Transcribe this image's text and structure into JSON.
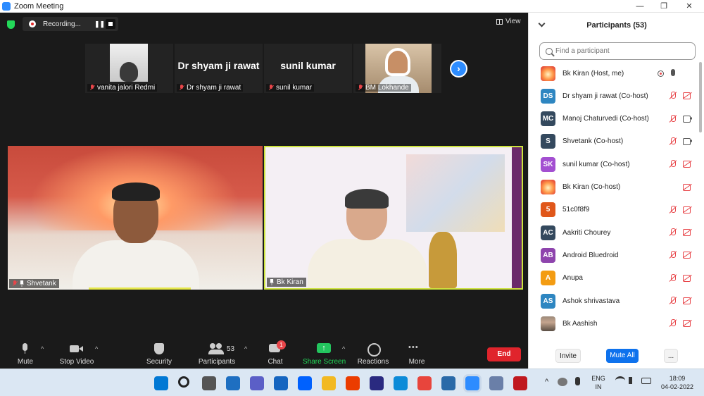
{
  "window": {
    "title": "Zoom Meeting",
    "minimize": "—",
    "maximize": "❐",
    "close": "✕"
  },
  "meeting": {
    "recording_label": "Recording...",
    "view_label": "View",
    "thumbnails": [
      {
        "label": "vanita jalori Redmi",
        "name_text": ""
      },
      {
        "label": "Dr shyam ji rawat",
        "name_text": "Dr shyam ji rawat"
      },
      {
        "label": "sunil kumar",
        "name_text": "sunil kumar"
      },
      {
        "label": "BM Lokhande",
        "name_text": ""
      }
    ],
    "tiles": [
      {
        "label": "Shvetank"
      },
      {
        "label": "Bk Kiran"
      }
    ]
  },
  "toolbar": {
    "mute": "Mute",
    "stop_video": "Stop Video",
    "security": "Security",
    "participants": "Participants",
    "participants_count": "53",
    "chat": "Chat",
    "chat_badge": "1",
    "share_screen": "Share Screen",
    "reactions": "Reactions",
    "more": "More",
    "end": "End"
  },
  "participants_panel": {
    "title": "Participants (53)",
    "search_placeholder": "Find a participant",
    "participants": [
      {
        "name": "Bk Kiran (Host, me)",
        "initials": "",
        "color": "#e8523a",
        "avatar": "sun",
        "mic": "on",
        "cam": "none",
        "rec": true
      },
      {
        "name": "Dr shyam ji rawat (Co-host)",
        "initials": "DS",
        "color": "#2e86c1",
        "avatar": "initials",
        "mic": "off",
        "cam": "off",
        "rec": false
      },
      {
        "name": "Manoj Chaturvedi (Co-host)",
        "initials": "MC",
        "color": "#34495e",
        "avatar": "initials",
        "mic": "off",
        "cam": "on",
        "rec": false
      },
      {
        "name": "Shvetank (Co-host)",
        "initials": "S",
        "color": "#34495e",
        "avatar": "initials",
        "mic": "off",
        "cam": "on",
        "rec": false
      },
      {
        "name": "sunil kumar (Co-host)",
        "initials": "SK",
        "color": "#a34fd1",
        "avatar": "initials",
        "mic": "off",
        "cam": "off",
        "rec": false
      },
      {
        "name": "Bk Kiran (Co-host)",
        "initials": "",
        "color": "#e8523a",
        "avatar": "sun",
        "mic": "none",
        "cam": "off",
        "rec": false
      },
      {
        "name": "51c0f8f9",
        "initials": "5",
        "color": "#e0571a",
        "avatar": "initials",
        "mic": "off",
        "cam": "off",
        "rec": false
      },
      {
        "name": "Aakriti Chourey",
        "initials": "AC",
        "color": "#34495e",
        "avatar": "initials",
        "mic": "off",
        "cam": "off",
        "rec": false
      },
      {
        "name": "Android Bluedroid",
        "initials": "AB",
        "color": "#8e44ad",
        "avatar": "initials",
        "mic": "off",
        "cam": "off",
        "rec": false
      },
      {
        "name": "Anupa",
        "initials": "A",
        "color": "#f39c12",
        "avatar": "initials",
        "mic": "off",
        "cam": "off",
        "rec": false
      },
      {
        "name": "Ashok shrivastava",
        "initials": "AS",
        "color": "#2e86c1",
        "avatar": "initials",
        "mic": "off",
        "cam": "off",
        "rec": false
      },
      {
        "name": "Bk Aashish",
        "initials": "",
        "color": "#9c8a7a",
        "avatar": "photo",
        "mic": "off",
        "cam": "off",
        "rec": false
      }
    ],
    "invite": "Invite",
    "mute_all": "Mute All",
    "more": "..."
  },
  "taskbar": {
    "language_top": "ENG",
    "language_bottom": "IN",
    "time": "18:09",
    "date": "04-02-2022",
    "icons": [
      "windows-icon",
      "search-icon",
      "task-view-icon",
      "widgets-icon",
      "teams-icon",
      "mail-icon",
      "dropbox-icon",
      "file-explorer-icon",
      "office-icon",
      "headset-icon",
      "edge-icon",
      "chrome-icon",
      "photos-icon",
      "zoom-icon",
      "vpn-icon",
      "mcafee-icon"
    ],
    "icon_colors": [
      "#0078d4",
      "#222222",
      "#555555",
      "#1e6fc1",
      "#5b5fc7",
      "#1565c0",
      "#0061fe",
      "#f2b922",
      "#eb3c00",
      "#2a2a80",
      "#0c8bd8",
      "#e8453c",
      "#2a6aa8",
      "#2d8cff",
      "#6a7fa8",
      "#c0181e"
    ]
  }
}
